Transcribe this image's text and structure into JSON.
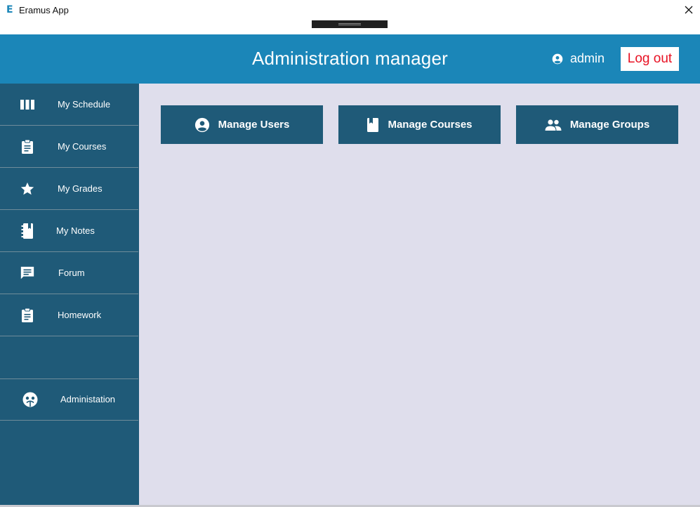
{
  "window": {
    "logo_letter": "E",
    "title": "Eramus App",
    "close_icon": "close-icon"
  },
  "header": {
    "title": "Administration manager",
    "user_icon": "user-circle-icon",
    "username": "admin",
    "logout_label": "Log out",
    "background": "#1b86b8",
    "logout_color": "#e81123"
  },
  "sidebar": {
    "background": "#1f5a78",
    "items": [
      {
        "label": "My Schedule",
        "icon": "schedule-columns-icon"
      },
      {
        "label": "My Courses",
        "icon": "clipboard-icon"
      },
      {
        "label": "My Grades",
        "icon": "star-icon"
      },
      {
        "label": "My Notes",
        "icon": "notebook-icon"
      },
      {
        "label": "Forum",
        "icon": "chat-icon"
      },
      {
        "label": "Homework",
        "icon": "clipboard-icon"
      },
      {
        "label": "Administation",
        "icon": "admin-face-icon"
      }
    ]
  },
  "main": {
    "background": "#dfdeec",
    "actions": [
      {
        "label": "Manage Users",
        "icon": "user-circle-icon"
      },
      {
        "label": "Manage Courses",
        "icon": "book-icon"
      },
      {
        "label": "Manage Groups",
        "icon": "group-icon"
      }
    ]
  }
}
